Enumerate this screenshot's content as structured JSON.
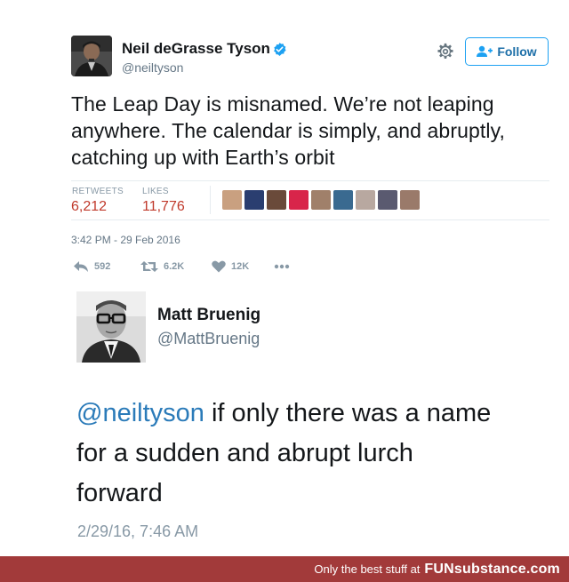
{
  "tweet": {
    "author_name": "Neil deGrasse Tyson",
    "author_handle": "@neiltyson",
    "follow_label": "Follow",
    "text": "The Leap Day is misnamed. We’re not leaping anywhere. The calendar is simply, and abruptly, catching up with Earth’s orbit",
    "retweets_label": "RETWEETS",
    "retweets_count": "6,212",
    "likes_label": "LIKES",
    "likes_count": "11,776",
    "timestamp": "3:42 PM - 29 Feb 2016",
    "actions": {
      "reply_count": "592",
      "retweet_count": "6.2K",
      "like_count": "12K"
    },
    "liker_avatar_colors": [
      "#c9a080",
      "#2a3e70",
      "#6a4a3a",
      "#d8254a",
      "#a0806a",
      "#3a6a90",
      "#b8a8a0",
      "#5a5a70",
      "#9a7a6a"
    ]
  },
  "reply": {
    "author_name": "Matt Bruenig",
    "author_handle": "@MattBruenig",
    "mention": "@neiltyson",
    "text": " if only there was a name for a sudden and abrupt lurch forward",
    "timestamp": "2/29/16, 7:46 AM"
  },
  "footer": {
    "tagline": "Only the best stuff at",
    "brand": "FUNsubstance.com"
  },
  "colors": {
    "accent": "#1da1f2",
    "mention": "#2b7bb9",
    "stat_value": "#c0392b",
    "footer_bg": "#a23a3a"
  }
}
